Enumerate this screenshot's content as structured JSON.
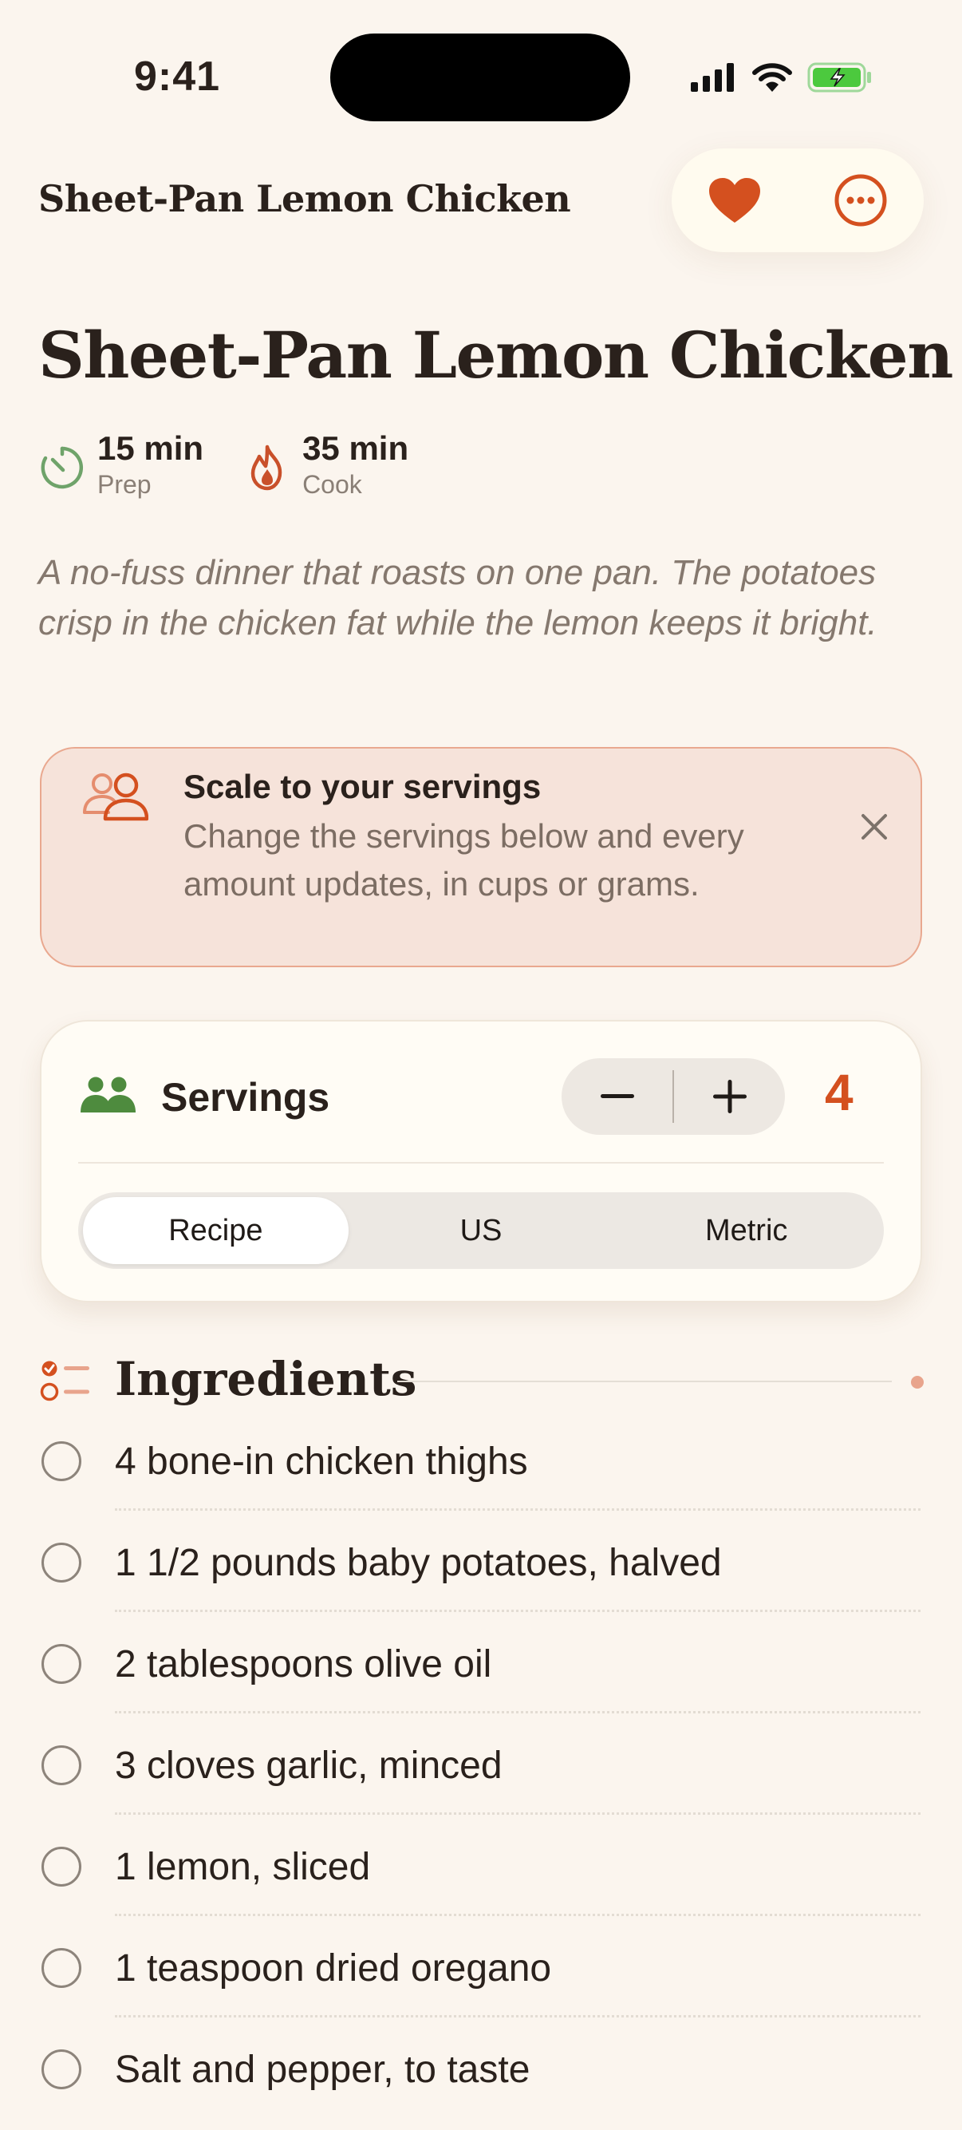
{
  "status_bar": {
    "time": "9:41",
    "icons": [
      "cellular-signal-icon",
      "wifi-icon",
      "battery-charging-icon"
    ]
  },
  "header": {
    "title": "Sheet-Pan Lemon Chicken",
    "actions": [
      "heart-icon",
      "more-options-icon"
    ]
  },
  "recipe": {
    "title": "Sheet-Pan Lemon Chicken",
    "prep_value": "15 min",
    "prep_label": "Prep",
    "cook_value": "35 min",
    "cook_label": "Cook",
    "description": "A no-fuss dinner that roasts on one pan. The potatoes crisp in the chicken fat while the lemon keeps it bright."
  },
  "tip": {
    "title": "Scale to your servings",
    "body": "Change the servings below and every amount updates, in cups or grams."
  },
  "servings": {
    "label": "Servings",
    "count": "4",
    "decrement": "−",
    "increment": "+",
    "units": [
      "Recipe",
      "US",
      "Metric"
    ],
    "selected_unit": "Recipe"
  },
  "ingredients": {
    "title": "Ingredients",
    "items": [
      "4 bone-in chicken thighs",
      "1 1/2 pounds baby potatoes, halved",
      "2 tablespoons olive oil",
      "3 cloves garlic, minced",
      "1 lemon, sliced",
      "1 teaspoon dried oregano",
      "Salt and pepper, to taste"
    ]
  },
  "colors": {
    "background": "#FBF5EE",
    "accent": "#D4501F",
    "green": "#4E8B3E",
    "tip_bg": "#F6E3DA",
    "tip_border": "#E9A88F"
  }
}
